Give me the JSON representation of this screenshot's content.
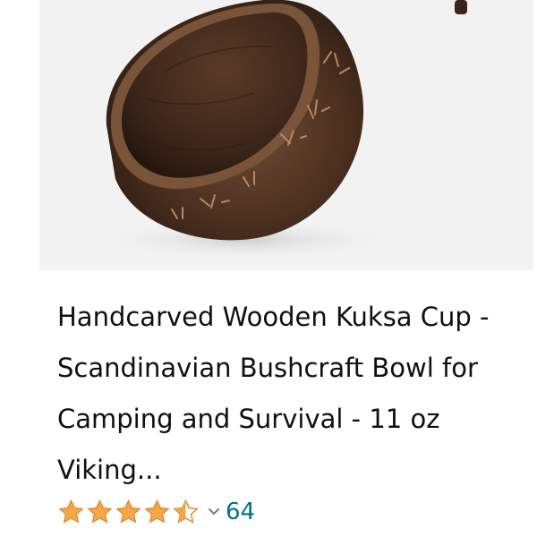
{
  "product": {
    "title": "Handcarved Wooden Kuksa Cup - Scandinavian Bushcraft Bowl for Camping and Survival - 11 oz Viking...",
    "image_icon": "kuksa-cup-photo",
    "rating": 4.5,
    "rating_max": 5,
    "review_count": "64",
    "star_color": "#f3a847",
    "link_color": "#007185"
  }
}
